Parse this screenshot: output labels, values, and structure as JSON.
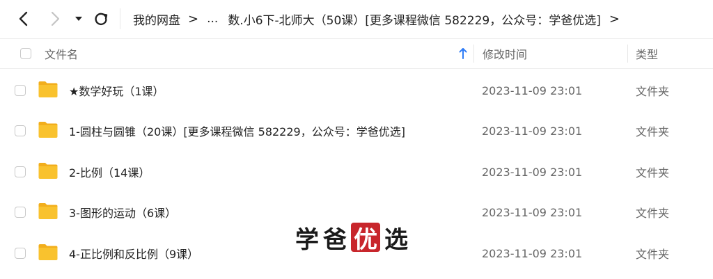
{
  "nav": {
    "back_icon": "chevron-left-icon",
    "forward_icon": "chevron-right-icon",
    "dropdown_icon": "caret-down-icon",
    "refresh_icon": "refresh-icon"
  },
  "breadcrumb": {
    "root": "我的网盘",
    "sep1": ">",
    "ellipsis": "...",
    "current": "数.小6下-北师大（50课）[更多课程微信 582229，公众号：学爸优选]",
    "trailing": ">"
  },
  "table": {
    "columns": {
      "name": "文件名",
      "modified": "修改时间",
      "type": "类型"
    },
    "rows": [
      {
        "name": "★数学好玩（1课）",
        "modified": "2023-11-09 23:01",
        "type": "文件夹"
      },
      {
        "name": "1-圆柱与圆锥（20课）[更多课程微信 582229，公众号：学爸优选]",
        "modified": "2023-11-09 23:01",
        "type": "文件夹"
      },
      {
        "name": "2-比例（14课）",
        "modified": "2023-11-09 23:01",
        "type": "文件夹"
      },
      {
        "name": "3-图形的运动（6课）",
        "modified": "2023-11-09 23:01",
        "type": "文件夹"
      },
      {
        "name": "4-正比例和反比例（9课）",
        "modified": "2023-11-09 23:01",
        "type": "文件夹"
      }
    ]
  },
  "watermark": {
    "part1": "学爸",
    "seal": "优",
    "part2": "选"
  },
  "colors": {
    "folder": "#f9c22e",
    "folder_dark": "#f2ae1c",
    "sort_arrow": "#2f7cf6",
    "seal": "#c8262c"
  }
}
